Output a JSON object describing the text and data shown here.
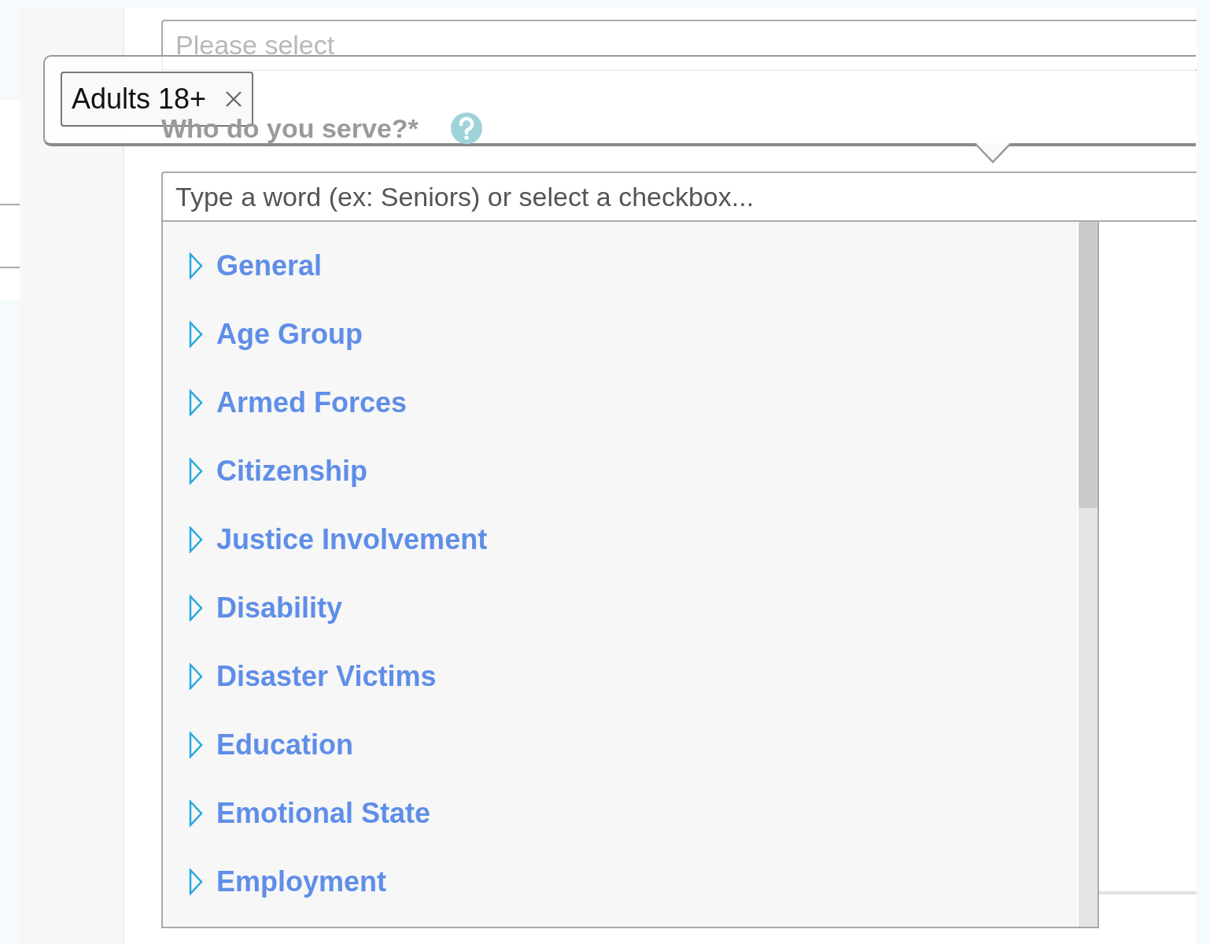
{
  "select": {
    "placeholder": "Please select"
  },
  "popup": {
    "tags": [
      {
        "label": "Adults 18+"
      }
    ]
  },
  "field_label": "Who do you serve?*",
  "search": {
    "placeholder": "Type a word (ex: Seniors) or select a checkbox..."
  },
  "categories": [
    {
      "label": "General",
      "expanded": false
    },
    {
      "label": "Age Group",
      "expanded": false
    },
    {
      "label": "Armed Forces",
      "expanded": false
    },
    {
      "label": "Citizenship",
      "expanded": false
    },
    {
      "label": "Justice Involvement",
      "expanded": false
    },
    {
      "label": "Disability",
      "expanded": false
    },
    {
      "label": "Disaster Victims",
      "expanded": false
    },
    {
      "label": "Education",
      "expanded": false
    },
    {
      "label": "Emotional State",
      "expanded": false
    },
    {
      "label": "Employment",
      "expanded": false
    }
  ]
}
